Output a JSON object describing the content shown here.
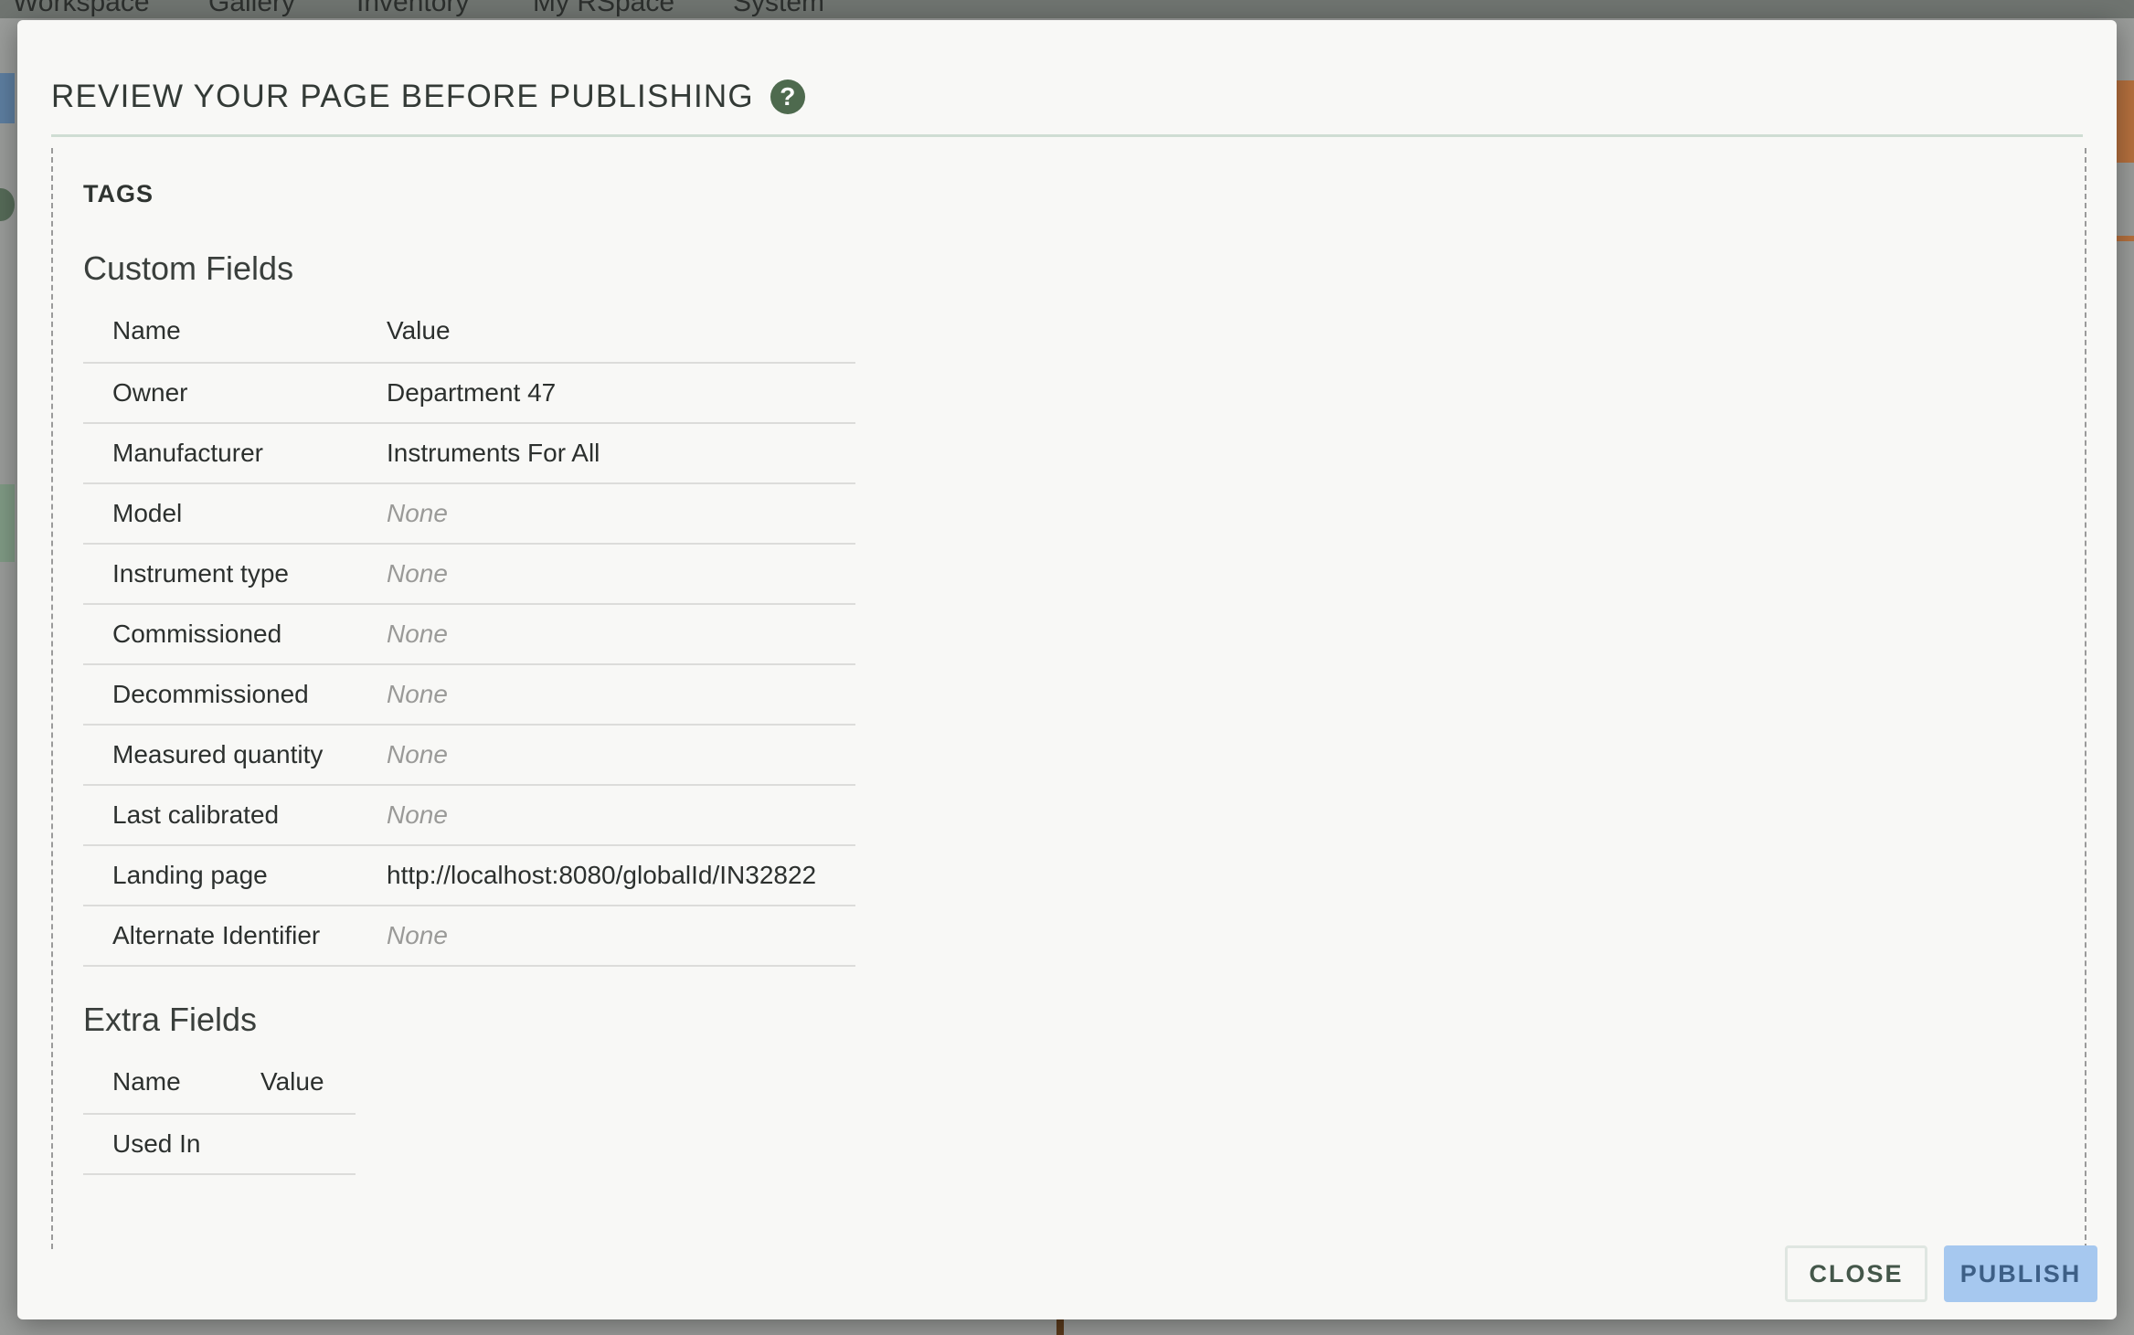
{
  "background_nav": {
    "items": [
      "Workspace",
      "Gallery",
      "Inventory",
      "My RSpace",
      "System"
    ]
  },
  "modal": {
    "title": "REVIEW YOUR PAGE BEFORE PUBLISHING",
    "help_icon": "?",
    "tags_heading": "TAGS",
    "custom_fields": {
      "title": "Custom Fields",
      "columns": [
        "Name",
        "Value"
      ],
      "rows": [
        {
          "name": "Owner",
          "value": "Department 47"
        },
        {
          "name": "Manufacturer",
          "value": "Instruments For All"
        },
        {
          "name": "Model",
          "value": "None"
        },
        {
          "name": "Instrument type",
          "value": "None"
        },
        {
          "name": "Commissioned",
          "value": "None"
        },
        {
          "name": "Decommissioned",
          "value": "None"
        },
        {
          "name": "Measured quantity",
          "value": "None"
        },
        {
          "name": "Last calibrated",
          "value": "None"
        },
        {
          "name": "Landing page",
          "value": "http://localhost:8080/globalId/IN32822"
        },
        {
          "name": "Alternate Identifier",
          "value": "None"
        }
      ]
    },
    "extra_fields": {
      "title": "Extra Fields",
      "columns": [
        "Name",
        "Value"
      ],
      "rows": [
        {
          "name": "Used In",
          "value": ""
        }
      ]
    },
    "buttons": {
      "close": "CLOSE",
      "publish": "PUBLISH"
    }
  },
  "colors": {
    "help_icon_bg": "#4e6a4e",
    "publish_bg": "#a6c8ef",
    "none_text": "#9a9a98"
  }
}
